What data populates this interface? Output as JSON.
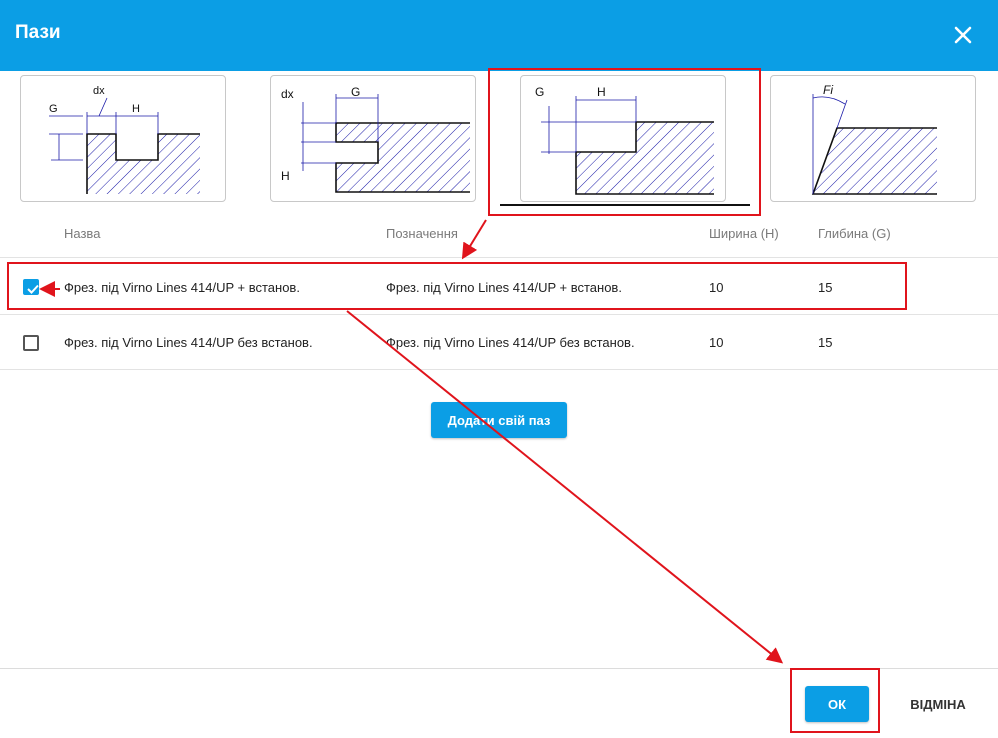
{
  "dialog": {
    "title": "Пази",
    "close_icon": "close-icon"
  },
  "diagrams": [
    {
      "labels": {
        "g": "G",
        "dx": "dx",
        "h": "H"
      }
    },
    {
      "labels": {
        "dx": "dx",
        "g": "G",
        "h": "H"
      }
    },
    {
      "labels": {
        "g": "G",
        "h": "H"
      }
    },
    {
      "labels": {
        "fi": "Fi"
      }
    }
  ],
  "table": {
    "headers": {
      "name": "Назва",
      "designation": "Позначення",
      "width": "Ширина (H)",
      "depth": "Глибина (G)"
    },
    "rows": [
      {
        "name": "Фрез. під Virno Lines 414/UP + встанов.",
        "designation": "Фрез. під Virno Lines 414/UP + встанов.",
        "width": "10",
        "depth": "15",
        "checked": true
      },
      {
        "name": "Фрез. під Virno Lines 414/UP без встанов.",
        "designation": "Фрез. під Virno Lines 414/UP без встанов.",
        "width": "10",
        "depth": "15",
        "checked": false
      }
    ]
  },
  "actions": {
    "add_label": "Додати свій паз",
    "ok_label": "ОК",
    "cancel_label": "ВІДМІНА"
  },
  "colors": {
    "accent": "#0b9ee5",
    "annotation": "#e0141c",
    "diagram_line": "#1a1aa8"
  }
}
